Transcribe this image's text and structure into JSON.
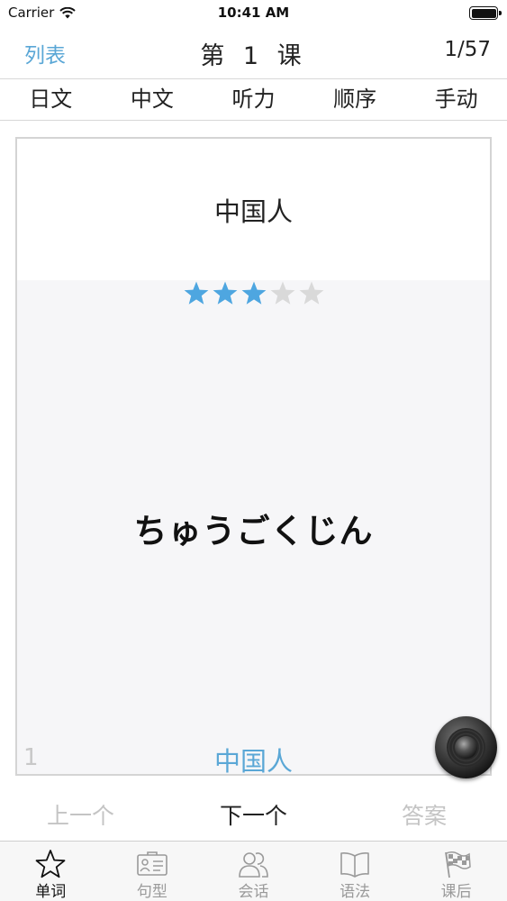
{
  "status_bar": {
    "carrier": "Carrier",
    "time": "10:41 AM"
  },
  "nav": {
    "left_label": "列表",
    "title": "第 1 课",
    "counter": "1/57"
  },
  "mode_tabs": [
    {
      "label": "日文"
    },
    {
      "label": "中文"
    },
    {
      "label": "听力"
    },
    {
      "label": "顺序"
    },
    {
      "label": "手动"
    }
  ],
  "card": {
    "meaning": "中国人",
    "rating": 3,
    "rating_max": 5,
    "reading": "ちゅうごくじん",
    "index": "1",
    "kanji": "中国人"
  },
  "actions": {
    "prev": "上一个",
    "next": "下一个",
    "answer": "答案"
  },
  "tab_bar": [
    {
      "label": "单词",
      "icon": "star-icon",
      "active": true
    },
    {
      "label": "句型",
      "icon": "id-card-icon",
      "active": false
    },
    {
      "label": "会话",
      "icon": "people-icon",
      "active": false
    },
    {
      "label": "语法",
      "icon": "book-icon",
      "active": false
    },
    {
      "label": "课后",
      "icon": "checkered-flag-icon",
      "active": false
    }
  ],
  "colors": {
    "accent": "#5aa7d6",
    "star_on": "#4ea6e0",
    "star_off": "#d9d9d9",
    "disabled_text": "#c4c4c4"
  }
}
